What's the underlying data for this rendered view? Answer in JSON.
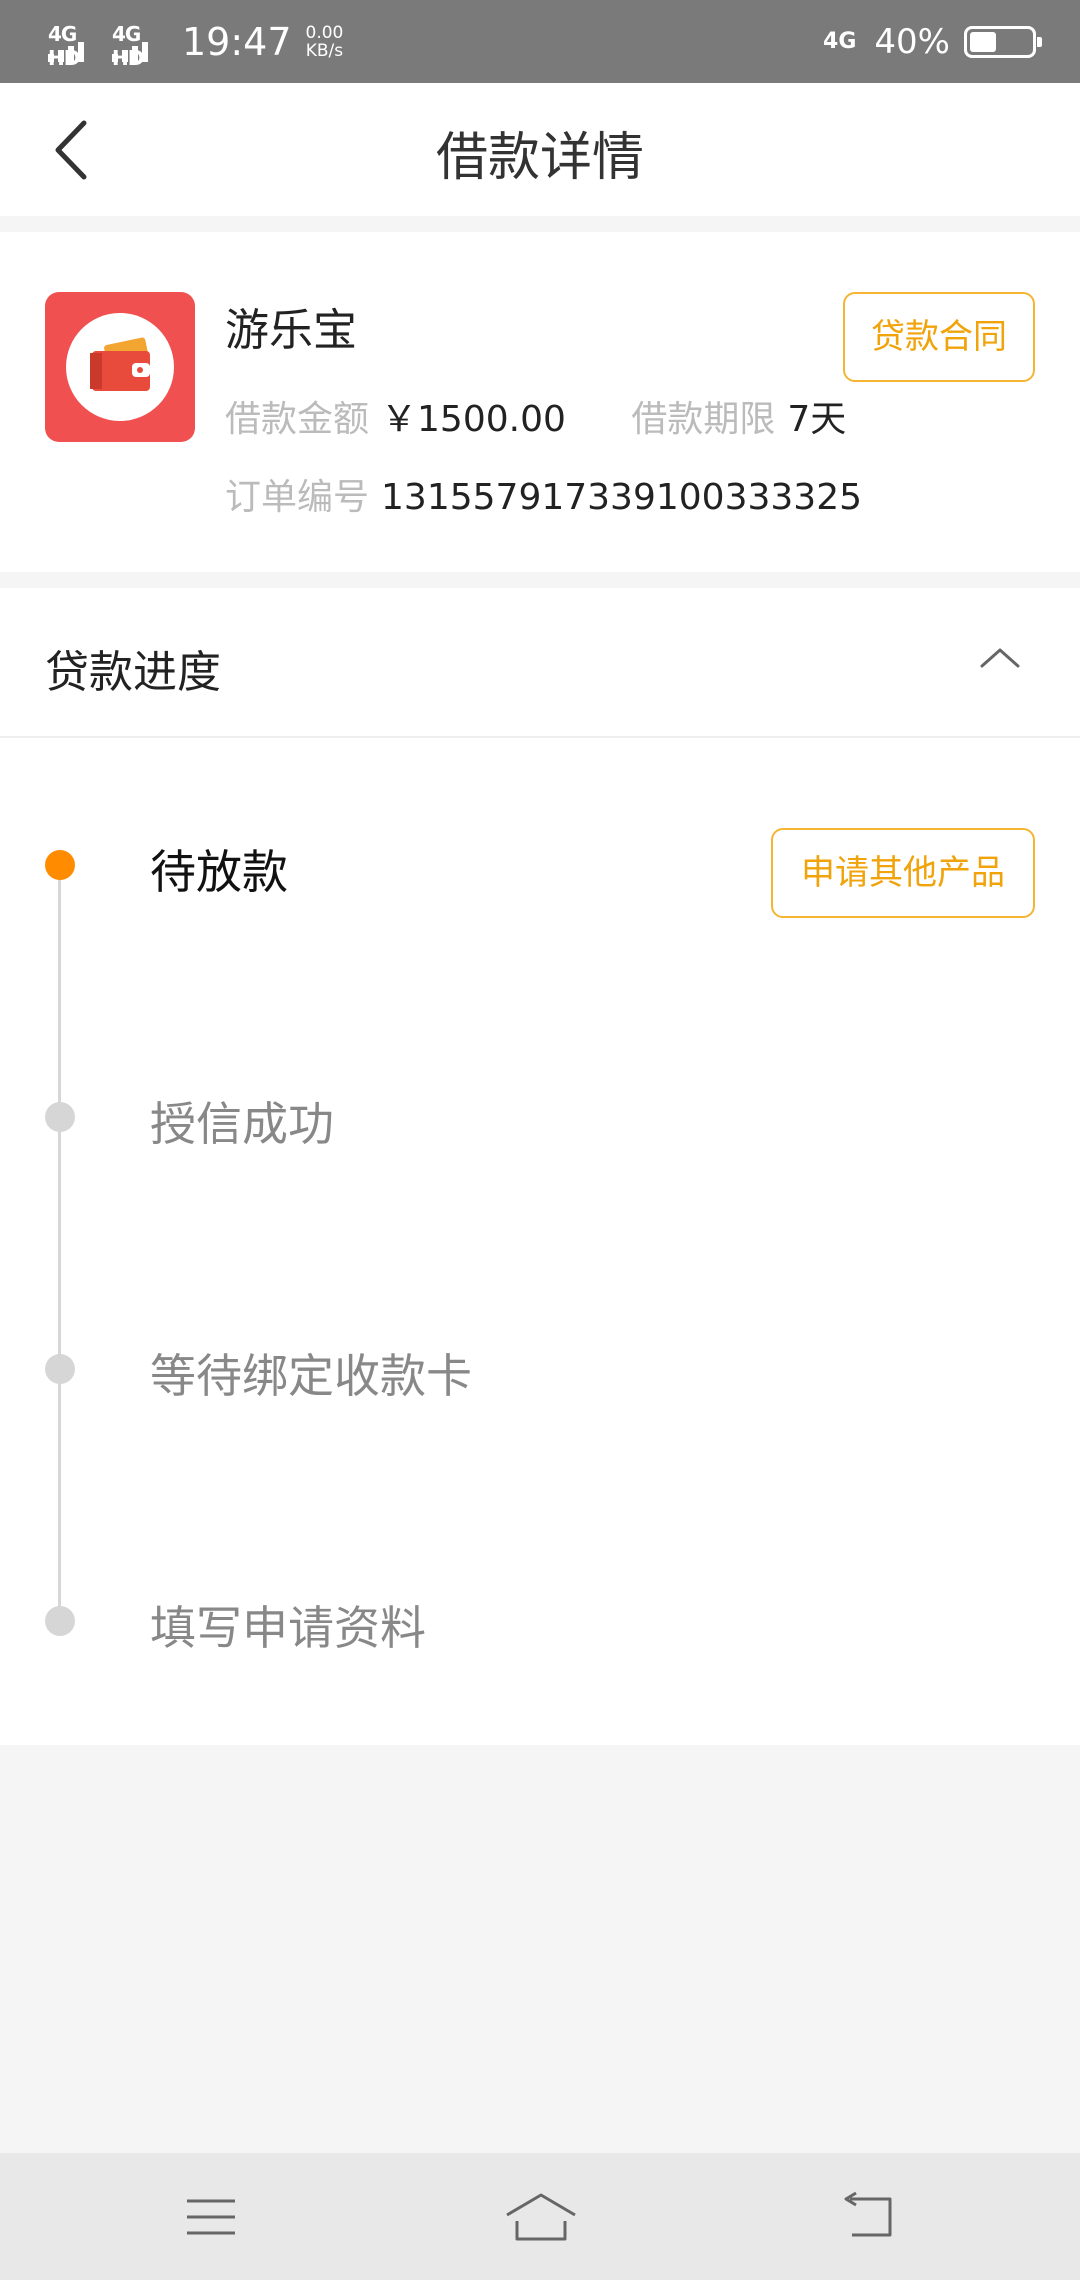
{
  "status_bar": {
    "signal1": "4G HD",
    "signal2": "4G HD",
    "time": "19:47",
    "speed_value": "0.00",
    "speed_unit": "KB/s",
    "network": "4G",
    "battery_pct": "40%",
    "battery_level": 0.4
  },
  "header": {
    "title": "借款详情"
  },
  "loan": {
    "app_name": "游乐宝",
    "amount_label": "借款金额",
    "amount_value": "￥1500.00",
    "term_label": "借款期限",
    "term_value": "7天",
    "order_label": "订单编号",
    "order_value": "131557917339100333325",
    "contract_button": "贷款合同"
  },
  "progress": {
    "title": "贷款进度",
    "apply_other_button": "申请其他产品",
    "steps": [
      {
        "label": "待放款",
        "active": true
      },
      {
        "label": "授信成功",
        "active": false
      },
      {
        "label": "等待绑定收款卡",
        "active": false
      },
      {
        "label": "填写申请资料",
        "active": false
      }
    ]
  },
  "colors": {
    "accent": "#f0a30a",
    "active_dot": "#ff8c00",
    "app_icon_bg": "#f05050"
  }
}
